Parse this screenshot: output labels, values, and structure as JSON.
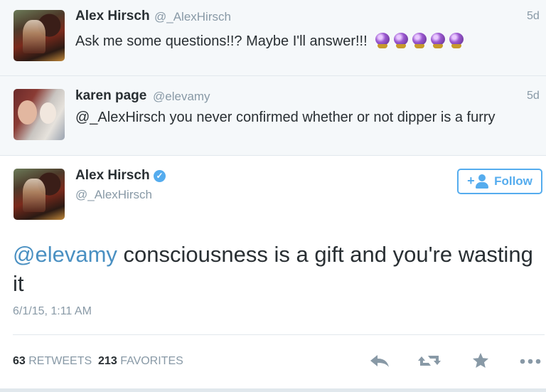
{
  "replies": [
    {
      "name": "Alex Hirsch",
      "handle": "@_AlexHirsch",
      "time": "5d",
      "text": "Ask me some questions!!? Maybe I'll answer!!!",
      "emoji_count": 5,
      "emoji_icon": "crystal-ball-icon"
    },
    {
      "name": "karen page",
      "handle": "@elevamy",
      "time": "5d",
      "text": "@_AlexHirsch you never confirmed whether or not dipper is a furry"
    }
  ],
  "main_tweet": {
    "name": "Alex Hirsch",
    "handle": "@_AlexHirsch",
    "verified": true,
    "follow_label": "Follow",
    "mention": "@elevamy",
    "text_line1": " consciousness is a gift and you're wasting",
    "text_line2": "it",
    "date": "6/1/15, 1:11 AM",
    "retweets_count": "63",
    "retweets_label": "RETWEETS",
    "favorites_count": "213",
    "favorites_label": "FAVORITES"
  },
  "colors": {
    "accent": "#55acee",
    "mention": "#4a90c2",
    "muted": "#8899a6",
    "text": "#292f33",
    "reply_bg": "#f5f8fa"
  }
}
